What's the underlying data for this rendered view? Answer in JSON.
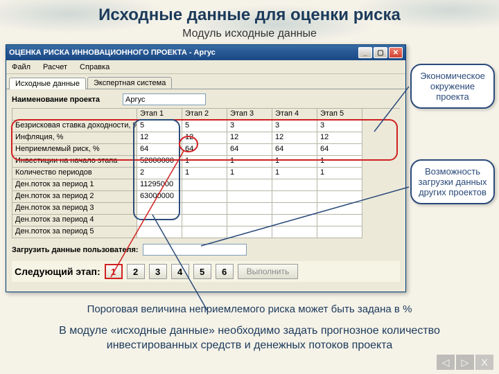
{
  "slide": {
    "title": "Исходные данные для оценки риска",
    "subtitle": "Модуль исходные данные"
  },
  "window": {
    "title": "ОЦЕНКА РИСКА ИННОВАЦИОННОГО ПРОЕКТА - Аргус",
    "menu": {
      "file": "Файл",
      "calc": "Расчет",
      "help": "Справка"
    },
    "tabs": {
      "data": "Исходные данные",
      "expert": "Экспертная система"
    },
    "project_label": "Наименование проекта",
    "project_value": "Аргус",
    "cols": [
      "Этап 1",
      "Этап 2",
      "Этап 3",
      "Этап 4",
      "Этап 5"
    ],
    "rows": [
      "Безрисковая ставка доходности, %",
      "Инфляция, %",
      "Неприемлемый риск, %",
      "Инвестиции на начало этапа",
      "Количество периодов",
      "Ден.поток за период 1",
      "Ден.поток за период 2",
      "Ден.поток за период 3",
      "Ден.поток за период 4",
      "Ден.поток за период 5"
    ],
    "vals": [
      [
        "5",
        "5",
        "3",
        "3",
        "3"
      ],
      [
        "12",
        "12",
        "12",
        "12",
        "12"
      ],
      [
        "64",
        "64",
        "64",
        "64",
        "64"
      ],
      [
        "52000000",
        "1",
        "1",
        "1",
        "1"
      ],
      [
        "2",
        "1",
        "1",
        "1",
        "1"
      ],
      [
        "11295000",
        "",
        "",
        "",
        ""
      ],
      [
        "63000000",
        "",
        "",
        "",
        ""
      ],
      [
        "",
        "",
        "",
        "",
        ""
      ],
      [
        "",
        "",
        "",
        "",
        ""
      ],
      [
        "",
        "",
        "",
        "",
        ""
      ]
    ],
    "load_label": "Загрузить данные пользователя:",
    "stage": {
      "label": "Следующий этап:",
      "buttons": [
        "1",
        "2",
        "3",
        "4",
        "5",
        "6"
      ],
      "exec": "Выполнить"
    }
  },
  "callouts": {
    "c1": "Экономическое окружение проекта",
    "c2": "Возможность загрузки данных других проектов"
  },
  "footer": {
    "l1": "Пороговая величина неприемлемого риска может быть задана в %",
    "l2": "В модуле «исходные данные» необходимо задать прогнозное количество инвестированных средств и денежных потоков проекта"
  },
  "nav": {
    "close": "X"
  }
}
